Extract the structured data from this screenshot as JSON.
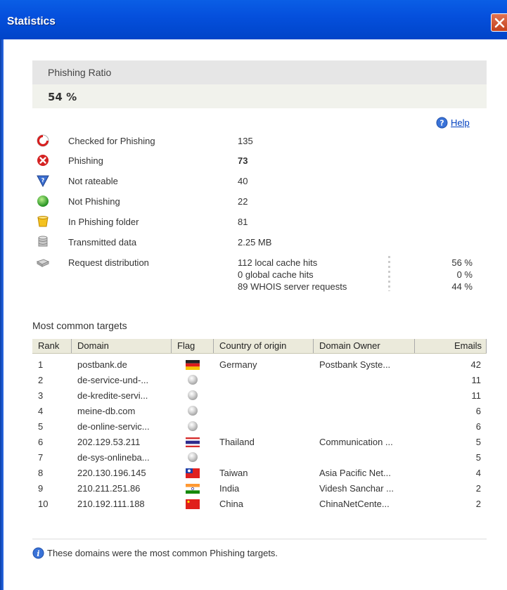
{
  "window": {
    "title": "Statistics"
  },
  "ratio": {
    "label": "Phishing Ratio",
    "value": "54 %"
  },
  "help": {
    "label": "Help"
  },
  "stats": [
    {
      "icon": "checked-icon",
      "label": "Checked for Phishing",
      "value": "135"
    },
    {
      "icon": "phishing-icon",
      "label": "Phishing",
      "value": "73"
    },
    {
      "icon": "not-rateable-icon",
      "label": "Not rateable",
      "value": "40"
    },
    {
      "icon": "not-phishing-icon",
      "label": "Not Phishing",
      "value": "22"
    },
    {
      "icon": "phishing-folder-icon",
      "label": "In Phishing folder",
      "value": "81"
    },
    {
      "icon": "database-icon",
      "label": "Transmitted data",
      "value": "2.25 MB"
    }
  ],
  "distribution": {
    "label": "Request distribution",
    "items": [
      {
        "text": "112 local cache hits",
        "pct": "56 %"
      },
      {
        "text": "0 global cache hits",
        "pct": "0 %"
      },
      {
        "text": "89 WHOIS server requests",
        "pct": "44 %"
      }
    ]
  },
  "targets": {
    "title": "Most common targets",
    "columns": [
      "Rank",
      "Domain",
      "Flag",
      "Country of origin",
      "Domain Owner",
      "Emails"
    ],
    "rows": [
      {
        "rank": "1",
        "domain": "postbank.de",
        "flag": "germany",
        "country": "Germany",
        "owner": "Postbank Syste...",
        "emails": "42"
      },
      {
        "rank": "2",
        "domain": "de-service-und-...",
        "flag": "unknown",
        "country": "",
        "owner": "",
        "emails": "11"
      },
      {
        "rank": "3",
        "domain": "de-kredite-servi...",
        "flag": "unknown",
        "country": "",
        "owner": "",
        "emails": "11"
      },
      {
        "rank": "4",
        "domain": "meine-db.com",
        "flag": "unknown",
        "country": "",
        "owner": "",
        "emails": "6"
      },
      {
        "rank": "5",
        "domain": "de-online-servic...",
        "flag": "unknown",
        "country": "",
        "owner": "",
        "emails": "6"
      },
      {
        "rank": "6",
        "domain": "202.129.53.211",
        "flag": "thailand",
        "country": "Thailand",
        "owner": "Communication ...",
        "emails": "5"
      },
      {
        "rank": "7",
        "domain": "de-sys-onlineba...",
        "flag": "unknown",
        "country": "",
        "owner": "",
        "emails": "5"
      },
      {
        "rank": "8",
        "domain": "220.130.196.145",
        "flag": "taiwan",
        "country": "Taiwan",
        "owner": "Asia Pacific Net...",
        "emails": "4"
      },
      {
        "rank": "9",
        "domain": "210.211.251.86",
        "flag": "india",
        "country": "India",
        "owner": "Videsh Sanchar ...",
        "emails": "2"
      },
      {
        "rank": "10",
        "domain": "210.192.111.188",
        "flag": "china",
        "country": "China",
        "owner": "ChinaNetCente...",
        "emails": "2"
      }
    ]
  },
  "footer": {
    "text": "These domains were the most common Phishing targets."
  }
}
